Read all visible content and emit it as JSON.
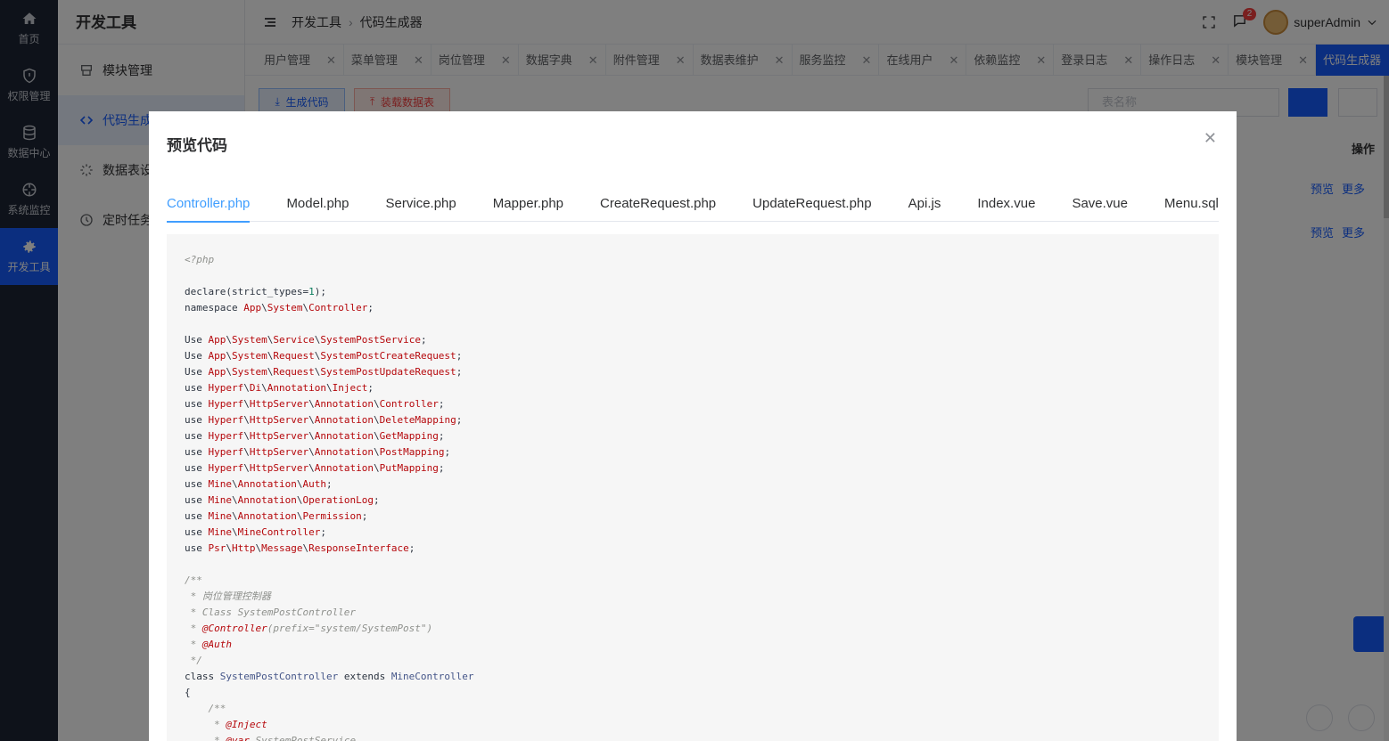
{
  "rail": [
    {
      "label": "首页",
      "icon": "home-icon"
    },
    {
      "label": "权限管理",
      "icon": "shield-icon"
    },
    {
      "label": "数据中心",
      "icon": "database-icon"
    },
    {
      "label": "系统监控",
      "icon": "crosshair-icon"
    },
    {
      "label": "开发工具",
      "icon": "gear-icon",
      "active": true
    }
  ],
  "sidebar": {
    "title": "开发工具",
    "items": [
      {
        "label": "模块管理",
        "icon": "module-icon"
      },
      {
        "label": "代码生成",
        "icon": "code-icon",
        "active": true
      },
      {
        "label": "数据表设",
        "icon": "loading-icon"
      },
      {
        "label": "定时任务",
        "icon": "clock-icon"
      }
    ]
  },
  "header": {
    "breadcrumb": [
      "开发工具",
      "代码生成器"
    ],
    "notification_count": "2",
    "username": "superAdmin"
  },
  "tabs": [
    "用户管理",
    "菜单管理",
    "岗位管理",
    "数据字典",
    "附件管理",
    "数据表维护",
    "服务监控",
    "在线用户",
    "依赖监控",
    "登录日志",
    "操作日志",
    "模块管理",
    "代码生成器"
  ],
  "active_tab": "代码生成器",
  "toolbar": {
    "generate": "生成代码",
    "load": "装载数据表",
    "search_placeholder": "表名称"
  },
  "table": {
    "ops_header": "操作",
    "rows": [
      {
        "preview": "预览",
        "more": "更多"
      },
      {
        "preview": "预览",
        "more": "更多"
      }
    ]
  },
  "modal": {
    "title": "预览代码",
    "tabs": [
      "Controller.php",
      "Model.php",
      "Service.php",
      "Mapper.php",
      "CreateRequest.php",
      "UpdateRequest.php",
      "Api.js",
      "Index.vue",
      "Save.vue",
      "Menu.sql"
    ],
    "active_tab": "Controller.php"
  }
}
